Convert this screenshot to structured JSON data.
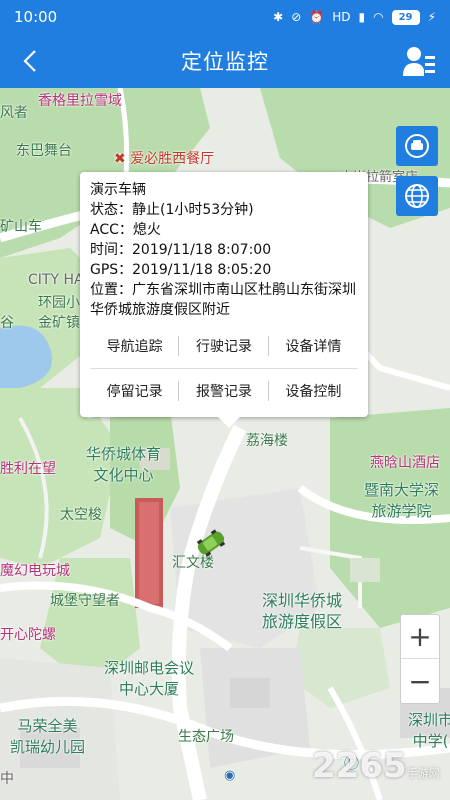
{
  "status_bar": {
    "time": "10:00",
    "network": "HD",
    "battery": "29"
  },
  "header": {
    "title": "定位监控",
    "back_icon": "chevron-left-icon",
    "user_icon": "user-list-icon"
  },
  "map": {
    "places": [
      "香格里拉雪域",
      "风者",
      "东巴舞台",
      "爱必胜西餐厅",
      "矿山车",
      "CITY HA",
      "环园小",
      "金矿镇",
      "谷",
      "胜利在望",
      "华侨城体育",
      "文化中心",
      "太空梭",
      "魔幻电玩城",
      "城堡守望者",
      "开心陀螺",
      "深圳邮电会议",
      "中心大厦",
      "马荣全美",
      "凯瑞幼儿园",
      "生态广场",
      "荔海楼",
      "燕晗山酒店",
      "暨南大学深",
      "旅游学院",
      "汇文楼",
      "深圳华侨城",
      "旅游度假区",
      "深圳市",
      "中学(",
      "水岸拉箭室店",
      "中"
    ],
    "colors": {
      "accent": "#1f7ee0",
      "park": "#b7dcaa",
      "road": "#ffffff"
    }
  },
  "popup": {
    "name": "演示车辆",
    "status": "状态：静止(1小时53分钟)",
    "acc": "ACC：熄火",
    "time": "时间：2019/11/18 8:07:00",
    "gps": "GPS：2019/11/18 8:05:20",
    "location": "位置：广东省深圳市南山区杜鹃山东街深圳华侨城旅游度假区附近",
    "buttons": [
      "导航追踪",
      "行驶记录",
      "设备详情",
      "停留记录",
      "报警记录",
      "设备控制"
    ]
  },
  "controls": {
    "locate_icon": "car-locate-icon",
    "layer_icon": "globe-icon",
    "zoom_in": "+",
    "zoom_out": "−"
  },
  "watermark": {
    "text": "2265",
    "sub": "手游网"
  }
}
